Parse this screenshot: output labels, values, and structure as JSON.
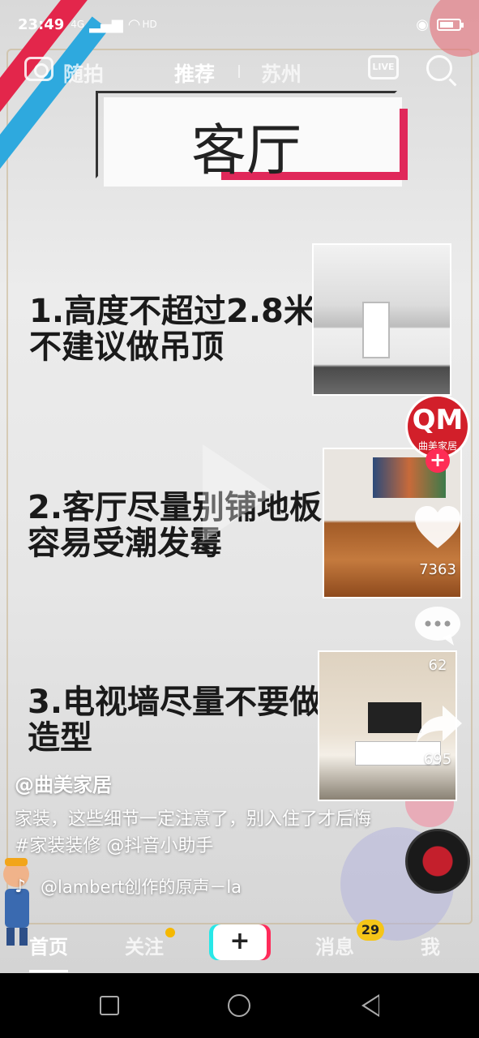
{
  "status_bar": {
    "time": "23:49",
    "signal": "4G",
    "hd": "HD"
  },
  "top_nav": {
    "snap_label": "随拍",
    "recommend_label": "推荐",
    "city_label": "苏州",
    "live_label": "LIVE"
  },
  "video": {
    "title": "客厅",
    "tips": [
      "1.高度不超过2.8米",
      "不建议做吊顶",
      "2.客厅尽量别铺地板",
      "容易受潮发霉",
      "3.电视墙尽量不要做",
      "造型"
    ]
  },
  "side_actions": {
    "avatar_logo": "QM",
    "avatar_sub": "曲美家居",
    "likes": "7363",
    "comments": "62",
    "shares": "695"
  },
  "caption": {
    "author": "@曲美家居",
    "description": "家装，这些细节一定注意了，别入住了才后悔#家装装修 @抖音小助手",
    "music": "@lambert创作的原声－la"
  },
  "tab_bar": {
    "home": "首页",
    "follow": "关注",
    "plus": "+",
    "messages": "消息",
    "messages_badge": "29",
    "me": "我"
  },
  "colors": {
    "accent_red": "#fe2c55",
    "accent_cyan": "#27e8e8",
    "badge_yellow": "#f5c518",
    "title_accent": "#e0285a"
  }
}
